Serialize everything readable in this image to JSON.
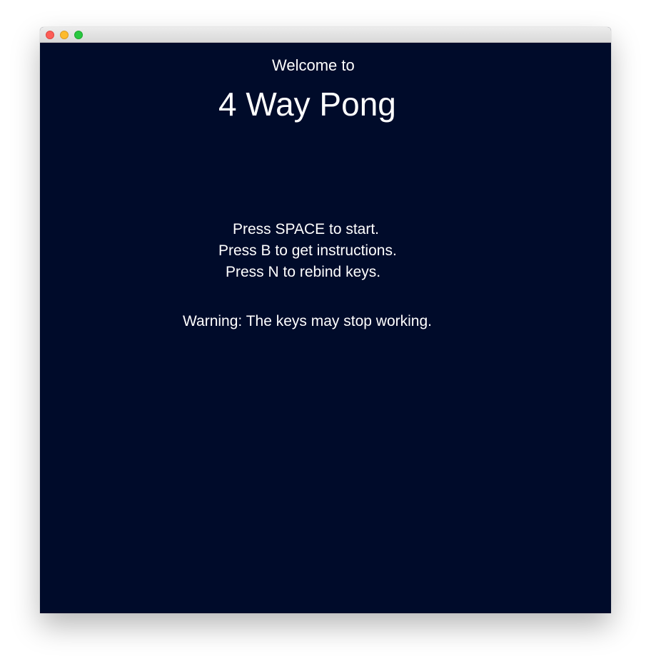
{
  "window": {
    "controls": [
      "close-button",
      "minimize-button",
      "zoom-button"
    ]
  },
  "game": {
    "welcome": "Welcome to",
    "title": "4 Way Pong",
    "instructions": [
      "Press SPACE to start.",
      "Press B to get instructions.",
      "Press N to rebind keys."
    ],
    "warning": "Warning: The keys may stop working."
  },
  "colors": {
    "background": "#000b2a",
    "text": "#ffffff",
    "close": "#fd5d57",
    "minimize": "#fdbb2d",
    "zoom": "#28c840"
  }
}
